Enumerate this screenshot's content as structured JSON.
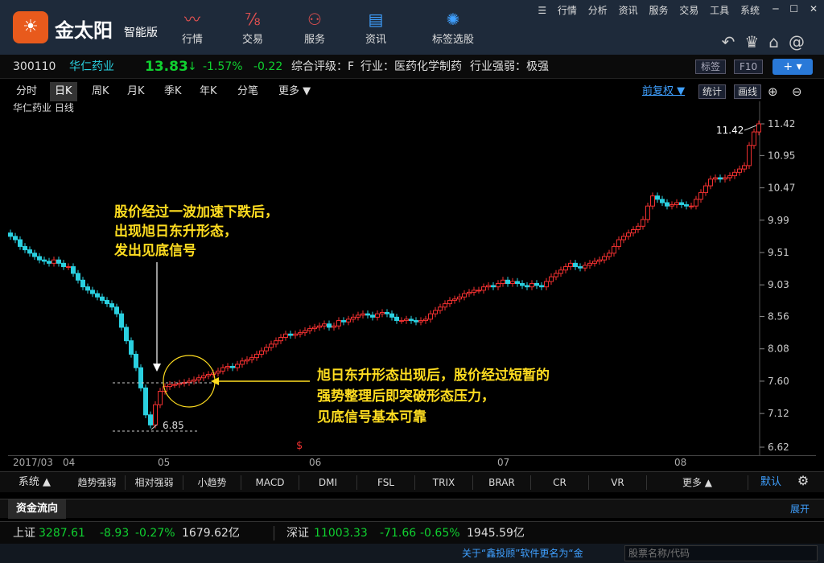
{
  "app": {
    "brand": "金太阳",
    "brand_sub": "智能版"
  },
  "nav": [
    {
      "label": "行情",
      "icon": "trend-line-icon"
    },
    {
      "label": "交易",
      "icon": "trade-icon"
    },
    {
      "label": "服务",
      "icon": "user-icon"
    },
    {
      "label": "资讯",
      "icon": "news-icon"
    },
    {
      "label": "标签选股",
      "icon": "lightbulb-icon"
    }
  ],
  "menu": [
    "行情",
    "分析",
    "资讯",
    "服务",
    "交易",
    "工具",
    "系统"
  ],
  "quote": {
    "code": "300110",
    "name": "华仁药业",
    "price": "13.83",
    "arrow": "↓",
    "change_pct": "-1.57%",
    "change": "-0.22",
    "rating": "综合评级：F",
    "industry": "行业：医药化学制药",
    "strength": "行业强弱：极强",
    "btn_tag": "标签",
    "btn_f10": "F10"
  },
  "tabs": [
    "分时",
    "日K",
    "周K",
    "月K",
    "季K",
    "年K",
    "分笔",
    "更多 ▼"
  ],
  "tabs_right": {
    "adjust": "前复权 ▼",
    "stats": "统计",
    "draw": "画线"
  },
  "chart_data": {
    "type": "candlestick",
    "title": "华仁药业  日线",
    "y_ticks": [
      "11.42",
      "10.95",
      "10.47",
      "9.99",
      "9.51",
      "9.03",
      "8.56",
      "8.08",
      "7.60",
      "7.12",
      "6.62"
    ],
    "ylim": [
      6.62,
      11.42
    ],
    "x_labels": [
      "2017/03",
      "04",
      "05",
      "06",
      "07",
      "08"
    ],
    "low_label": "6.85",
    "high_label": "11.42",
    "marker": "$",
    "annotation1": [
      "股价经过一波加速下跌后，",
      "出现旭日东升形态，",
      "发出见底信号"
    ],
    "annotation2": [
      "旭日东升形态出现后，股价经过短暂的",
      "强势整理后即突破形态压力，",
      "见底信号基本可靠"
    ]
  },
  "indicators": {
    "system": "系统 ▲",
    "items": [
      "趋势强弱",
      "相对强弱",
      "小趋势",
      "MACD",
      "DMI",
      "FSL",
      "TRIX",
      "BRAR",
      "CR",
      "VR",
      "更多 ▲"
    ],
    "default": "默认"
  },
  "fund": {
    "label": "资金流向",
    "expand": "展开"
  },
  "status": {
    "sh_label": "上证",
    "sh_value": "3287.61",
    "sh_change": "-8.93",
    "sh_pct": "-0.27%",
    "sh_amount": "1679.62亿",
    "sz_label": "深证",
    "sz_value": "11003.33",
    "sz_change": "-71.66",
    "sz_pct": "-0.65%",
    "sz_amount": "1945.59亿"
  },
  "bottom": {
    "notice": "关于“鑫投顾”软件更名为“金",
    "search_placeholder": "股票名称/代码"
  }
}
